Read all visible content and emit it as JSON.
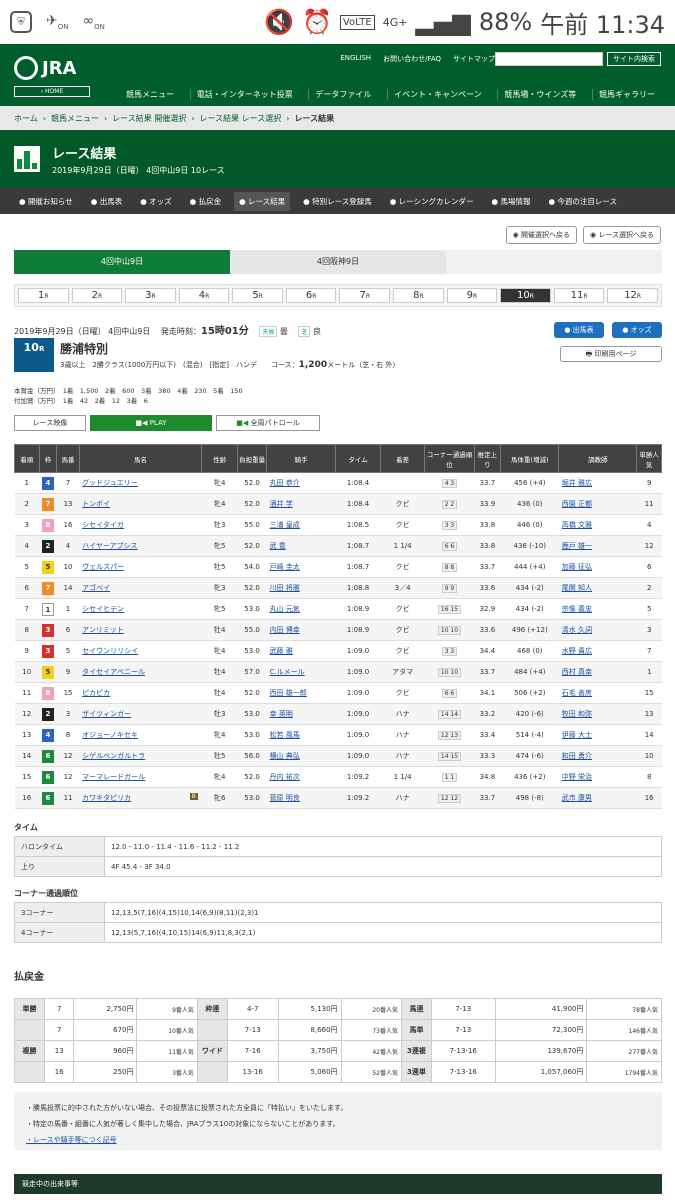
{
  "statusbar": {
    "battery": "88%",
    "time": "午前 11:34",
    "net": "4G+",
    "volte": "VoLTE",
    "on1": "ON",
    "on2": "ON"
  },
  "header": {
    "logo": "JRA",
    "home": "HOME",
    "english": "ENGLISH",
    "contact": "お問い合わせ/FAQ",
    "sitemap": "サイトマップ",
    "search_btn": "サイト内検索",
    "nav": [
      "競馬メニュー",
      "電話・インターネット投票",
      "データファイル",
      "イベント・キャンペーン",
      "競馬場・ウインズ等",
      "競馬ギャラリー"
    ]
  },
  "breadcrumb": [
    "ホーム",
    "競馬メニュー",
    "レース結果 開催選択",
    "レース結果 レース選択",
    "レース結果"
  ],
  "title": {
    "main": "レース結果",
    "sub": "2019年9月29日（日曜） 4回中山9日 10レース"
  },
  "subnav": [
    "開催お知らせ",
    "出馬表",
    "オッズ",
    "払戻金",
    "レース結果",
    "特別レース登録馬",
    "レーシングカレンダー",
    "馬場情報",
    "今週の注目レース"
  ],
  "top_buttons": [
    "開催選択へ戻る",
    "レース選択へ戻る"
  ],
  "venues": [
    "4回中山9日",
    "4回阪神9日",
    ""
  ],
  "races": [
    "1",
    "2",
    "3",
    "4",
    "5",
    "6",
    "7",
    "8",
    "9",
    "10",
    "11",
    "12"
  ],
  "race_suffix": "R",
  "info": {
    "date": "2019年9月29日（日曜） 4回中山9日",
    "start_label": "発走時刻：",
    "start": "15時01分",
    "weather_label": "天候",
    "weather": "曇",
    "track_label": "芝",
    "track": "良",
    "no": "10",
    "no_suffix": "R",
    "name": "勝浦特別",
    "cond": "3歳以上　2勝クラス(1000万円以下)　(混合)　[指定]　ハンデ",
    "course_label": "コース：",
    "course": "1,200",
    "course_unit": "メートル（芝・右 外）",
    "btn_entry": "出馬表",
    "btn_odds": "オッズ",
    "btn_print": "印刷用ページ",
    "prize1": "本賞金（万円）　1着　1,500　2着　600　3着　380　4着　230　5着　150",
    "prize2": "付加賞（万円）　1着　42　2着　12　3着　6"
  },
  "video": {
    "label": "レース映像",
    "play": "PLAY",
    "patrol": "全周パトロール"
  },
  "table": {
    "headers": [
      "着順",
      "枠",
      "馬番",
      "馬名",
      "性齢",
      "負担重量",
      "騎手",
      "タイム",
      "着差",
      "コーナー通過順位",
      "推定上り",
      "馬体重(増減)",
      "調教師",
      "単勝人気"
    ],
    "rows": [
      [
        "1",
        "4",
        "7",
        "グッドジュエリー",
        "牝4",
        "52.0",
        "丸田 恭介",
        "1:08.4",
        "",
        "4 3",
        "33.7",
        "456 (+4)",
        "堀井 雅広",
        "9"
      ],
      [
        "2",
        "7",
        "13",
        "トンボイ",
        "牝4",
        "52.0",
        "酒井 学",
        "1:08.4",
        "クビ",
        "2 2",
        "33.9",
        "436 (0)",
        "西園 正都",
        "11"
      ],
      [
        "3",
        "8",
        "16",
        "シセイタイガ",
        "牡3",
        "55.0",
        "三浦 皇成",
        "1:08.5",
        "クビ",
        "3 3",
        "33.8",
        "446 (0)",
        "高橋 文雅",
        "4"
      ],
      [
        "4",
        "2",
        "4",
        "ハイヤーアプシス",
        "牝5",
        "52.0",
        "武 豊",
        "1:08.7",
        "1 1/4",
        "6 6",
        "33.8",
        "436 (-10)",
        "鹿戸 雄一",
        "12"
      ],
      [
        "5",
        "5",
        "10",
        "ヴェルスパー",
        "牡5",
        "54.0",
        "戸崎 圭太",
        "1:08.7",
        "クビ",
        "8 8",
        "33.7",
        "444 (+4)",
        "加藤 征弘",
        "6"
      ],
      [
        "6",
        "7",
        "14",
        "アゴベイ",
        "牝3",
        "52.0",
        "川田 将雅",
        "1:08.8",
        "3／4",
        "9 9",
        "33.6",
        "434 (-2)",
        "尾関 知人",
        "2"
      ],
      [
        "7",
        "1",
        "1",
        "シセイヒテン",
        "牝5",
        "53.0",
        "丸山 元気",
        "1:08.9",
        "クビ",
        "16 15",
        "32.9",
        "434 (-2)",
        "宗像 義忠",
        "5"
      ],
      [
        "8",
        "3",
        "6",
        "アンリミット",
        "牡4",
        "55.0",
        "内田 博幸",
        "1:08.9",
        "クビ",
        "10 10",
        "33.6",
        "496 (+12)",
        "清水 久詞",
        "3"
      ],
      [
        "9",
        "3",
        "5",
        "セイウンリリシイ",
        "牝4",
        "53.0",
        "武藤 雅",
        "1:09.0",
        "クビ",
        "3 3",
        "34.4",
        "468 (0)",
        "水野 貴広",
        "7"
      ],
      [
        "10",
        "5",
        "9",
        "タイセイアベニール",
        "牡4",
        "57.0",
        "C.ルメール",
        "1:09.0",
        "アタマ",
        "10 10",
        "33.7",
        "484 (+4)",
        "西村 真幸",
        "1"
      ],
      [
        "11",
        "8",
        "15",
        "ピカピカ",
        "牡4",
        "52.0",
        "西田 雄一郎",
        "1:09.0",
        "クビ",
        "6 6",
        "34.1",
        "506 (+2)",
        "石毛 善房",
        "15"
      ],
      [
        "12",
        "2",
        "3",
        "ザイツィンガー",
        "牡3",
        "53.0",
        "幸 英明",
        "1:09.0",
        "ハナ",
        "14 14",
        "33.2",
        "420 (-6)",
        "牧田 和弥",
        "13"
      ],
      [
        "13",
        "4",
        "8",
        "オジョーノキセキ",
        "牝4",
        "53.0",
        "松若 風馬",
        "1:09.0",
        "ハナ",
        "12 13",
        "33.4",
        "514 (-4)",
        "伊藤 大士",
        "14"
      ],
      [
        "14",
        "6",
        "12",
        "シゲルベンガルトラ",
        "牡5",
        "56.0",
        "横山 典弘",
        "1:09.0",
        "ハナ",
        "14 15",
        "33.3",
        "474 (-6)",
        "和田 勇介",
        "10"
      ],
      [
        "15",
        "6",
        "12",
        "マーマレードガール",
        "牝4",
        "52.0",
        "丹内 祐次",
        "1:09.2",
        "1 1/4",
        "1 1",
        "34.8",
        "436 (+2)",
        "中野 栄治",
        "8"
      ],
      [
        "16",
        "6",
        "11",
        "カワキタピリカ",
        "牝6",
        "53.0",
        "菅原 明良",
        "1:09.2",
        "ハナ",
        "12 12",
        "33.7",
        "498 (-8)",
        "武市 康男",
        "16"
      ]
    ],
    "blinker": "B"
  },
  "time_section": {
    "title": "タイム",
    "rows": [
      [
        "ハロンタイム",
        "12.0 - 11.0 - 11.4 - 11.6 - 11.2 - 11.2"
      ],
      [
        "上り",
        "4F 45.4 - 3F 34.0"
      ]
    ]
  },
  "corner_section": {
    "title": "コーナー通過順位",
    "rows": [
      [
        "3コーナー",
        "12,13,5(7,16)(4,15)10,14(6,9)(8,11)(2,3)1"
      ],
      [
        "4コーナー",
        "12,13(5,7,16)(4,10,15)14(6,9)11,8,3(2,1)"
      ]
    ]
  },
  "payout": {
    "title": "払戻金",
    "rows": [
      [
        "単勝",
        "7",
        "2,750円",
        "9番人気",
        "枠連",
        "4-7",
        "5,130円",
        "20番人気",
        "馬連",
        "7-13",
        "41,900円",
        "78番人気"
      ],
      [
        "",
        "7",
        "670円",
        "10番人気",
        "",
        "7-13",
        "8,660円",
        "73番人気",
        "馬単",
        "7-13",
        "72,300円",
        "146番人気"
      ],
      [
        "複勝",
        "13",
        "960円",
        "11番人気",
        "ワイド",
        "7-16",
        "3,750円",
        "42番人気",
        "3連複",
        "7-13-16",
        "139,670円",
        "277番人気"
      ],
      [
        "",
        "16",
        "250円",
        "3番人気",
        "",
        "13-16",
        "5,060円",
        "52番人気",
        "3連単",
        "7-13-16",
        "1,057,060円",
        "1794番人気"
      ]
    ]
  },
  "notes": [
    "勝馬投票に的中された方がいない場合、その投票法に投票された方全員に「特払い」をいたします。",
    "特定の馬番・組番に人気が著しく集中した場合、JRAプラス10の対象にならないことがあります。",
    "レースや騎手等につく記号"
  ],
  "footer": "競走中の出来事等",
  "colors": {
    "green": "#005e2e",
    "waku": [
      "#ffffff",
      "#ffffff",
      "#222222",
      "#d63030",
      "#2a62c8",
      "#f0d21a",
      "#1b8a3a",
      "#f08a24",
      "#f3a0c0"
    ]
  }
}
